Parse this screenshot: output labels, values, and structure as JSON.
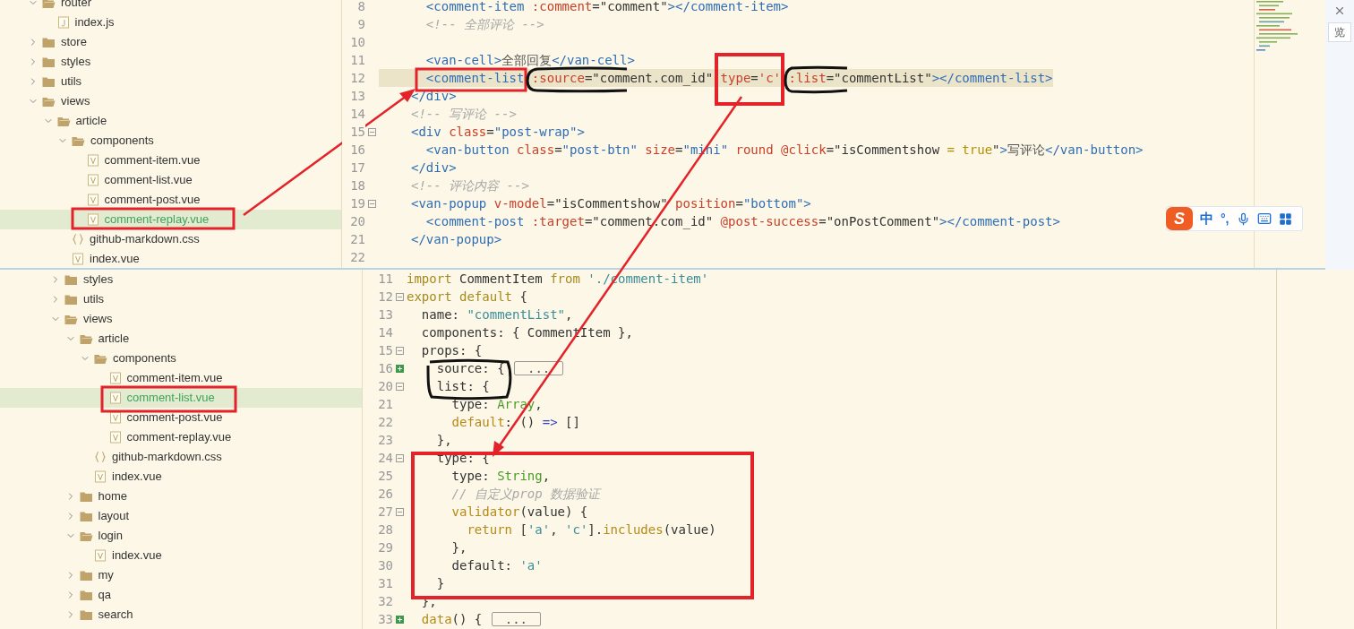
{
  "top_window": {
    "file_tree": [
      {
        "name": "router",
        "kind": "folder",
        "expanded": true,
        "selected": false,
        "children": [
          {
            "name": "index.js",
            "kind": "js",
            "selected": false
          }
        ]
      },
      {
        "name": "store",
        "kind": "folder",
        "expanded": false,
        "selected": false
      },
      {
        "name": "styles",
        "kind": "folder",
        "expanded": false,
        "selected": false
      },
      {
        "name": "utils",
        "kind": "folder",
        "expanded": false,
        "selected": false
      },
      {
        "name": "views",
        "kind": "folder",
        "expanded": true,
        "selected": false,
        "children": [
          {
            "name": "article",
            "kind": "folder",
            "expanded": true,
            "selected": false,
            "children": [
              {
                "name": "components",
                "kind": "folder",
                "expanded": true,
                "selected": false,
                "children": [
                  {
                    "name": "comment-item.vue",
                    "kind": "vue",
                    "selected": false
                  },
                  {
                    "name": "comment-list.vue",
                    "kind": "vue",
                    "selected": false
                  },
                  {
                    "name": "comment-post.vue",
                    "kind": "vue",
                    "selected": false
                  },
                  {
                    "name": "comment-replay.vue",
                    "kind": "vue",
                    "selected": true
                  }
                ]
              },
              {
                "name": "github-markdown.css",
                "kind": "css",
                "selected": false
              },
              {
                "name": "index.vue",
                "kind": "vue",
                "selected": false
              }
            ]
          }
        ]
      }
    ],
    "editor": {
      "lines": [
        {
          "number": "8",
          "current": false,
          "tokens": [
            {
              "kind": "tag",
              "text": "  <comment-item"
            },
            {
              "kind": "attr",
              "text": " :comment"
            },
            {
              "kind": "punct",
              "text": "="
            },
            {
              "kind": "expr",
              "text": "\"comment\""
            },
            {
              "kind": "tag",
              "text": "></comment-item>"
            }
          ]
        },
        {
          "number": "9",
          "current": false,
          "tokens": [
            {
              "kind": "comment",
              "text": "  <!-- 全部评论 -->"
            }
          ]
        },
        {
          "number": "10",
          "current": false
        },
        {
          "number": "11",
          "current": false,
          "tokens": [
            {
              "kind": "tag",
              "text": "  <van-cell>"
            },
            {
              "kind": "text",
              "text": "全部回复"
            },
            {
              "kind": "tag",
              "text": "</van-cell>"
            }
          ]
        },
        {
          "number": "12",
          "current": true,
          "tokens": [
            {
              "kind": "tag",
              "text": "  <comment-list"
            },
            {
              "kind": "attr",
              "text": " :source"
            },
            {
              "kind": "punct",
              "text": "="
            },
            {
              "kind": "expr",
              "text": "\"comment.com_id\""
            },
            {
              "kind": "attr",
              "text": " type"
            },
            {
              "kind": "punct",
              "text": "="
            },
            {
              "kind": "attr",
              "text": "'c'"
            },
            {
              "kind": "attr",
              "text": " :list"
            },
            {
              "kind": "punct",
              "text": "="
            },
            {
              "kind": "expr",
              "text": "\"commentList\""
            },
            {
              "kind": "tag",
              "text": "></comment-list>"
            }
          ]
        },
        {
          "number": "13",
          "current": false,
          "tokens": [
            {
              "kind": "tag",
              "text": "</div>"
            }
          ]
        },
        {
          "number": "14",
          "current": false,
          "tokens": [
            {
              "kind": "comment",
              "text": "<!-- 写评论 -->"
            }
          ]
        },
        {
          "number": "15",
          "current": false,
          "collapsed": false,
          "tokens": [
            {
              "kind": "tag",
              "text": "<div"
            },
            {
              "kind": "attr",
              "text": " class"
            },
            {
              "kind": "punct",
              "text": "="
            },
            {
              "kind": "str",
              "text": "\"post-wrap\""
            },
            {
              "kind": "tag",
              "text": ">"
            }
          ]
        },
        {
          "number": "16",
          "current": false,
          "tokens": [
            {
              "kind": "tag",
              "text": "  <van-button"
            },
            {
              "kind": "attr",
              "text": " class"
            },
            {
              "kind": "punct",
              "text": "="
            },
            {
              "kind": "str",
              "text": "\"post-btn\""
            },
            {
              "kind": "attr",
              "text": " size"
            },
            {
              "kind": "punct",
              "text": "="
            },
            {
              "kind": "str",
              "text": "\"mini\""
            },
            {
              "kind": "attr",
              "text": " round @click"
            },
            {
              "kind": "punct",
              "text": "="
            },
            {
              "kind": "expr",
              "text": "\"isCommentshow "
            },
            {
              "kind": "keyword",
              "text": "= true"
            },
            {
              "kind": "expr",
              "text": "\""
            },
            {
              "kind": "tag",
              "text": ">"
            },
            {
              "kind": "text",
              "text": "写评论"
            },
            {
              "kind": "tag",
              "text": "</van-button>"
            }
          ]
        },
        {
          "number": "17",
          "current": false,
          "tokens": [
            {
              "kind": "tag",
              "text": "</div>"
            }
          ]
        },
        {
          "number": "18",
          "current": false,
          "tokens": [
            {
              "kind": "comment",
              "text": "<!-- 评论内容 -->"
            }
          ]
        },
        {
          "number": "19",
          "current": false,
          "collapsed": false,
          "tokens": [
            {
              "kind": "tag",
              "text": "<van-popup"
            },
            {
              "kind": "attr",
              "text": " v-model"
            },
            {
              "kind": "punct",
              "text": "="
            },
            {
              "kind": "expr",
              "text": "\"isCommentshow\""
            },
            {
              "kind": "attr",
              "text": " position"
            },
            {
              "kind": "punct",
              "text": "="
            },
            {
              "kind": "str",
              "text": "\"bottom\""
            },
            {
              "kind": "tag",
              "text": ">"
            }
          ]
        },
        {
          "number": "20",
          "current": false,
          "tokens": [
            {
              "kind": "tag",
              "text": "  <comment-post"
            },
            {
              "kind": "attr",
              "text": " :target"
            },
            {
              "kind": "punct",
              "text": "="
            },
            {
              "kind": "expr",
              "text": "\"comment.com_id\""
            },
            {
              "kind": "attr",
              "text": " @post-success"
            },
            {
              "kind": "punct",
              "text": "="
            },
            {
              "kind": "expr",
              "text": "\"onPostComment\""
            },
            {
              "kind": "tag",
              "text": "></comment-post>"
            }
          ]
        },
        {
          "number": "21",
          "current": false,
          "tokens": [
            {
              "kind": "tag",
              "text": "</van-popup>"
            }
          ]
        },
        {
          "number": "22",
          "current": false
        }
      ]
    }
  },
  "background_window": {
    "button_text": "览"
  },
  "ime_toolbar": {
    "logo": "S",
    "mode": "中",
    "punctuation": "°,"
  },
  "bottom_window": {
    "file_tree": [
      {
        "name": "styles",
        "kind": "folder",
        "expanded": false,
        "selected": false
      },
      {
        "name": "utils",
        "kind": "folder",
        "expanded": false,
        "selected": false
      },
      {
        "name": "views",
        "kind": "folder",
        "expanded": true,
        "selected": false,
        "children": [
          {
            "name": "article",
            "kind": "folder",
            "expanded": true,
            "selected": false,
            "children": [
              {
                "name": "components",
                "kind": "folder",
                "expanded": true,
                "selected": false,
                "children": [
                  {
                    "name": "comment-item.vue",
                    "kind": "vue",
                    "selected": false
                  },
                  {
                    "name": "comment-list.vue",
                    "kind": "vue",
                    "selected": true
                  },
                  {
                    "name": "comment-post.vue",
                    "kind": "vue",
                    "selected": false
                  },
                  {
                    "name": "comment-replay.vue",
                    "kind": "vue",
                    "selected": false
                  }
                ]
              },
              {
                "name": "github-markdown.css",
                "kind": "css",
                "selected": false
              },
              {
                "name": "index.vue",
                "kind": "vue",
                "selected": false
              }
            ]
          },
          {
            "name": "home",
            "kind": "folder",
            "expanded": false,
            "selected": false
          },
          {
            "name": "layout",
            "kind": "folder",
            "expanded": false,
            "selected": false
          },
          {
            "name": "login",
            "kind": "folder",
            "expanded": true,
            "selected": false,
            "children": [
              {
                "name": "index.vue",
                "kind": "vue",
                "selected": false
              }
            ]
          },
          {
            "name": "my",
            "kind": "folder",
            "expanded": false,
            "selected": false
          },
          {
            "name": "qa",
            "kind": "folder",
            "expanded": false,
            "selected": false
          },
          {
            "name": "search",
            "kind": "folder",
            "expanded": false,
            "selected": false
          }
        ]
      }
    ],
    "editor": {
      "lines": [
        {
          "number": "11",
          "tokens": [
            {
              "kind": "jskw",
              "text": "import"
            },
            {
              "kind": "plain",
              "text": " CommentItem "
            },
            {
              "kind": "jskw",
              "text": "from"
            },
            {
              "kind": "jsstr",
              "text": " './comment-item'"
            }
          ]
        },
        {
          "number": "12",
          "collapsed": false,
          "tokens": [
            {
              "kind": "jskw",
              "text": "export default"
            },
            {
              "kind": "plain",
              "text": " {"
            }
          ]
        },
        {
          "number": "13",
          "tokens": [
            {
              "kind": "plain",
              "text": "  name: "
            },
            {
              "kind": "jsstr",
              "text": "\"commentList\""
            },
            {
              "kind": "plain",
              "text": ","
            }
          ]
        },
        {
          "number": "14",
          "tokens": [
            {
              "kind": "plain",
              "text": "  components: { CommentItem },"
            }
          ]
        },
        {
          "number": "15",
          "collapsed": false,
          "tokens": [
            {
              "kind": "plain",
              "text": "  props: {"
            }
          ]
        },
        {
          "number": "16",
          "collapsed": true,
          "tokens": [
            {
              "kind": "plain",
              "text": "    source: { "
            }
          ],
          "folded": "..."
        },
        {
          "number": "20",
          "collapsed": false,
          "tokens": [
            {
              "kind": "plain",
              "text": "    list: {"
            }
          ]
        },
        {
          "number": "21",
          "tokens": [
            {
              "kind": "plain",
              "text": "      type: "
            },
            {
              "kind": "type",
              "text": "Array"
            },
            {
              "kind": "plain",
              "text": ","
            }
          ]
        },
        {
          "number": "22",
          "tokens": [
            {
              "kind": "fn",
              "text": "      default"
            },
            {
              "kind": "plain",
              "text": ": () "
            },
            {
              "kind": "op",
              "text": "=>"
            },
            {
              "kind": "plain",
              "text": " []"
            }
          ]
        },
        {
          "number": "23",
          "tokens": [
            {
              "kind": "plain",
              "text": "    },"
            }
          ]
        },
        {
          "number": "24",
          "collapsed": false,
          "tokens": [
            {
              "kind": "plain",
              "text": "    type: {"
            }
          ]
        },
        {
          "number": "25",
          "tokens": [
            {
              "kind": "plain",
              "text": "      type: "
            },
            {
              "kind": "type",
              "text": "String"
            },
            {
              "kind": "plain",
              "text": ","
            }
          ]
        },
        {
          "number": "26",
          "tokens": [
            {
              "kind": "comment",
              "text": "      // 自定义prop 数据验证"
            }
          ]
        },
        {
          "number": "27",
          "collapsed": false,
          "tokens": [
            {
              "kind": "fn",
              "text": "      validator"
            },
            {
              "kind": "plain",
              "text": "(value) {"
            }
          ]
        },
        {
          "number": "28",
          "tokens": [
            {
              "kind": "fn",
              "text": "        return"
            },
            {
              "kind": "plain",
              "text": " ["
            },
            {
              "kind": "jsstr",
              "text": "'a'"
            },
            {
              "kind": "plain",
              "text": ", "
            },
            {
              "kind": "jsstr",
              "text": "'c'"
            },
            {
              "kind": "plain",
              "text": "]."
            },
            {
              "kind": "fn",
              "text": "includes"
            },
            {
              "kind": "plain",
              "text": "(value)"
            }
          ]
        },
        {
          "number": "29",
          "tokens": [
            {
              "kind": "plain",
              "text": "      },"
            }
          ]
        },
        {
          "number": "30",
          "tokens": [
            {
              "kind": "plain",
              "text": "      default: "
            },
            {
              "kind": "jsstr",
              "text": "'a'"
            }
          ]
        },
        {
          "number": "31",
          "tokens": [
            {
              "kind": "plain",
              "text": "    }"
            }
          ]
        },
        {
          "number": "32",
          "tokens": [
            {
              "kind": "plain",
              "text": "  },"
            }
          ]
        },
        {
          "number": "33",
          "collapsed": true,
          "tokens": [
            {
              "kind": "fn",
              "text": "  data"
            },
            {
              "kind": "plain",
              "text": "() { "
            }
          ],
          "folded": "..."
        }
      ]
    }
  }
}
